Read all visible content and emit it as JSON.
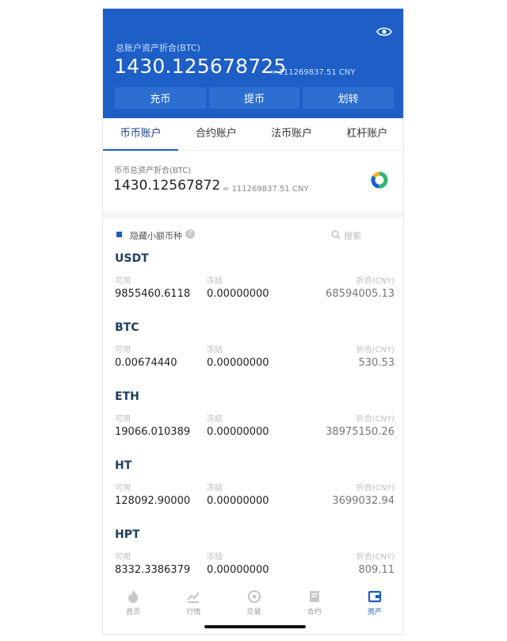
{
  "header": {
    "total_label": "总账户资产折合(BTC)",
    "total_btc": "1430.125678725",
    "total_cny": "≈ 111269837.51 CNY",
    "buttons": [
      "充币",
      "提币",
      "划转"
    ],
    "bg_color": "#1d5fc7"
  },
  "tabs": [
    {
      "label": "币币账户",
      "active": true
    },
    {
      "label": "合约账户",
      "active": false
    },
    {
      "label": "法币账户",
      "active": false
    },
    {
      "label": "杠杆账户",
      "active": false
    }
  ],
  "summary": {
    "label": "币币总资产折合(BTC)",
    "total_btc": "1430.12567872",
    "total_cny": "≈ 111269837.51 CNY",
    "chart_icon": "pie-chart-icon"
  },
  "filter": {
    "hide_small_label": "隐藏小额币种",
    "help_glyph": "?",
    "search_placeholder": "搜索"
  },
  "columns": {
    "available": "可用",
    "frozen": "冻结",
    "value": "折合(CNY)"
  },
  "coins": [
    {
      "name": "USDT",
      "available": "9855460.6118",
      "frozen": "0.00000000",
      "value": "68594005.13"
    },
    {
      "name": "BTC",
      "available": "0.00674440",
      "frozen": "0.00000000",
      "value": "530.53"
    },
    {
      "name": "ETH",
      "available": "19066.010389",
      "frozen": "0.00000000",
      "value": "38975150.26"
    },
    {
      "name": "HT",
      "available": "128092.90000",
      "frozen": "0.00000000",
      "value": "3699032.94"
    },
    {
      "name": "HPT",
      "available": "8332.3386379",
      "frozen": "0.00000000",
      "value": "809.11"
    }
  ],
  "nav": [
    {
      "label": "首页",
      "icon": "home-icon",
      "active": false
    },
    {
      "label": "行情",
      "icon": "market-icon",
      "active": false
    },
    {
      "label": "交易",
      "icon": "trade-icon",
      "active": false
    },
    {
      "label": "合约",
      "icon": "contract-icon",
      "active": false
    },
    {
      "label": "资产",
      "icon": "wallet-icon",
      "active": true
    }
  ]
}
